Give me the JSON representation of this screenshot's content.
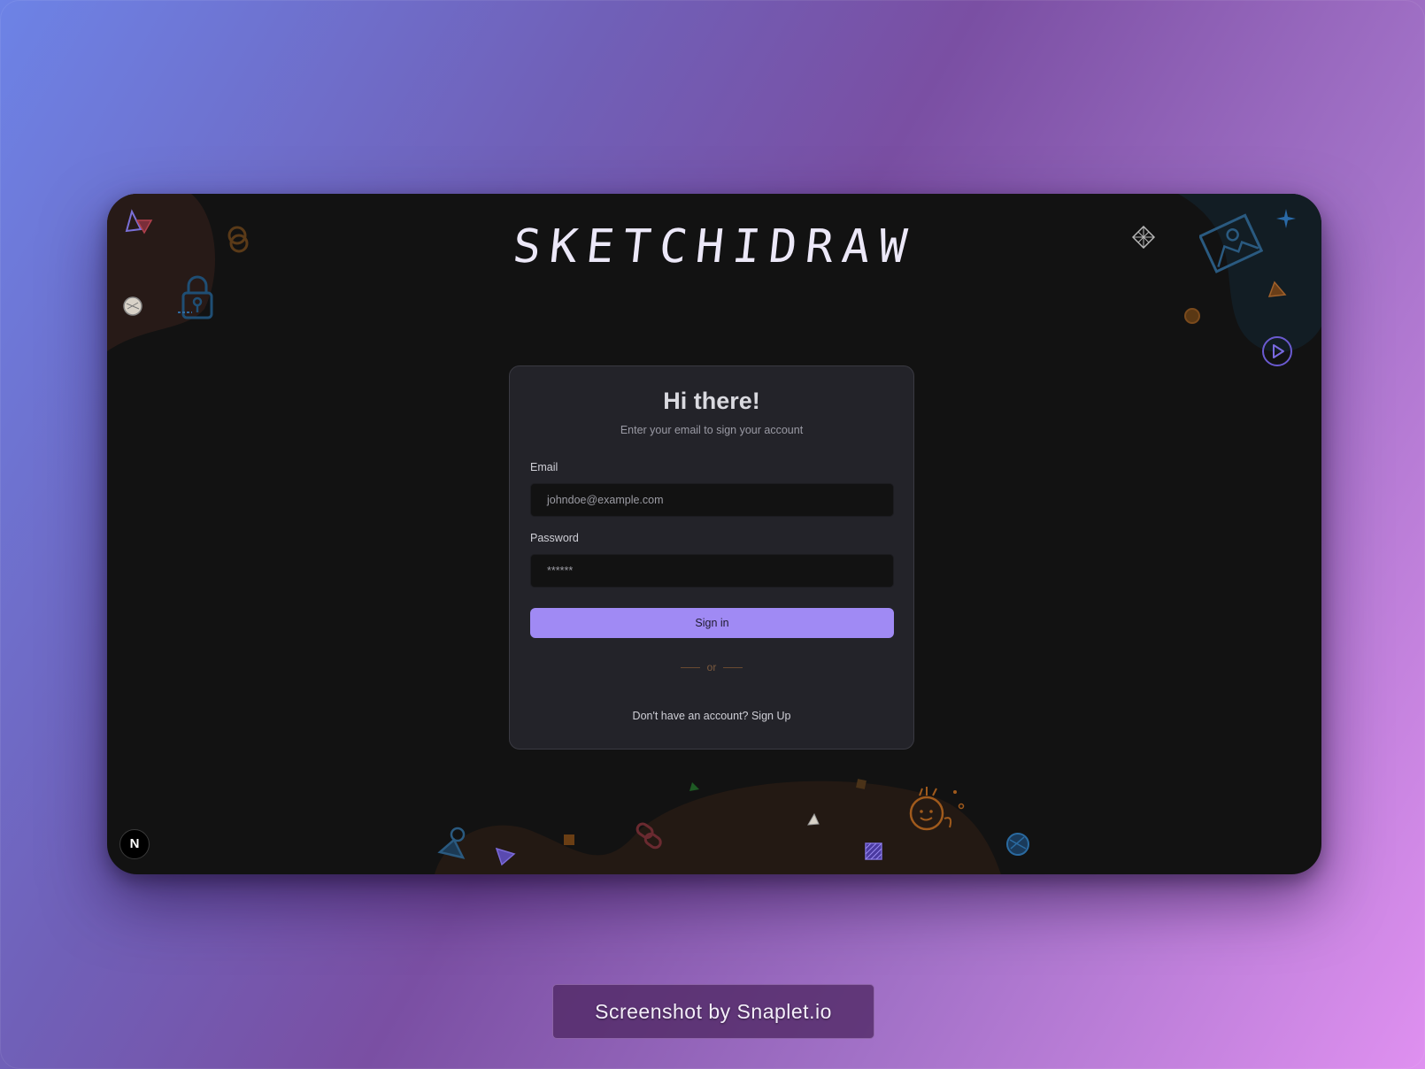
{
  "app": {
    "logo_text": "SKETCHIDRAW"
  },
  "signin_card": {
    "title": "Hi there!",
    "subtitle": "Enter your email to sign your account",
    "email_label": "Email",
    "email_placeholder": "johndoe@example.com",
    "password_label": "Password",
    "password_placeholder": "******",
    "signin_label": "Sign in",
    "divider_text": "or",
    "signup_text": "Don't have an account? Sign Up"
  },
  "dev_badge": {
    "label": "N"
  },
  "watermark": {
    "text": "Screenshot by Snaplet.io"
  },
  "colors": {
    "accent": "#a08af4",
    "card_bg": "#232329",
    "app_bg": "#121212"
  }
}
